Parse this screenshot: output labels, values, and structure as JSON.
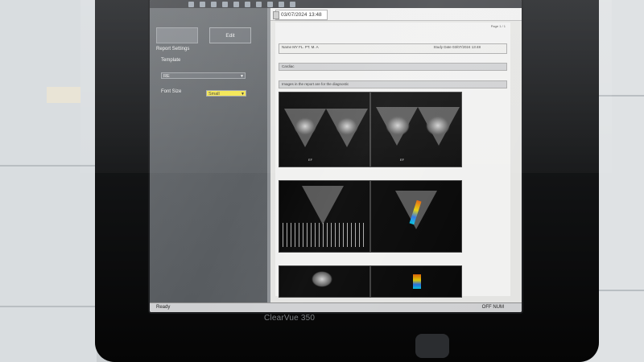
{
  "screen": {
    "tab": {
      "label": "03/07/2024 13:48"
    },
    "left_panel": {
      "edit_button": "Edit",
      "report_settings_label": "Report Settings",
      "template_label": "Template",
      "template_select_value": "RE",
      "font_size_label": "Font Size",
      "font_size_select_value": "Small"
    },
    "report": {
      "page_counter": "Page 1 / 1",
      "patient_row_left": "Name  MY FL. PT. M. A",
      "patient_row_right": "Study Date  03/07/2024 13:48",
      "section_cardiac": "Cardiac",
      "section_images": "Images in the report are for the diagnostic",
      "us_captions": [
        "EF",
        "EF",
        "",
        "",
        "",
        ""
      ]
    },
    "status": {
      "ready": "Ready",
      "mode": "OFF NUM"
    }
  },
  "bezel": {
    "brand": "ClearVue 350"
  },
  "colors": {
    "accent_yellow": "#f4e64a",
    "panel_gray": "#5f6367",
    "doc_background": "#f1f1f0"
  }
}
